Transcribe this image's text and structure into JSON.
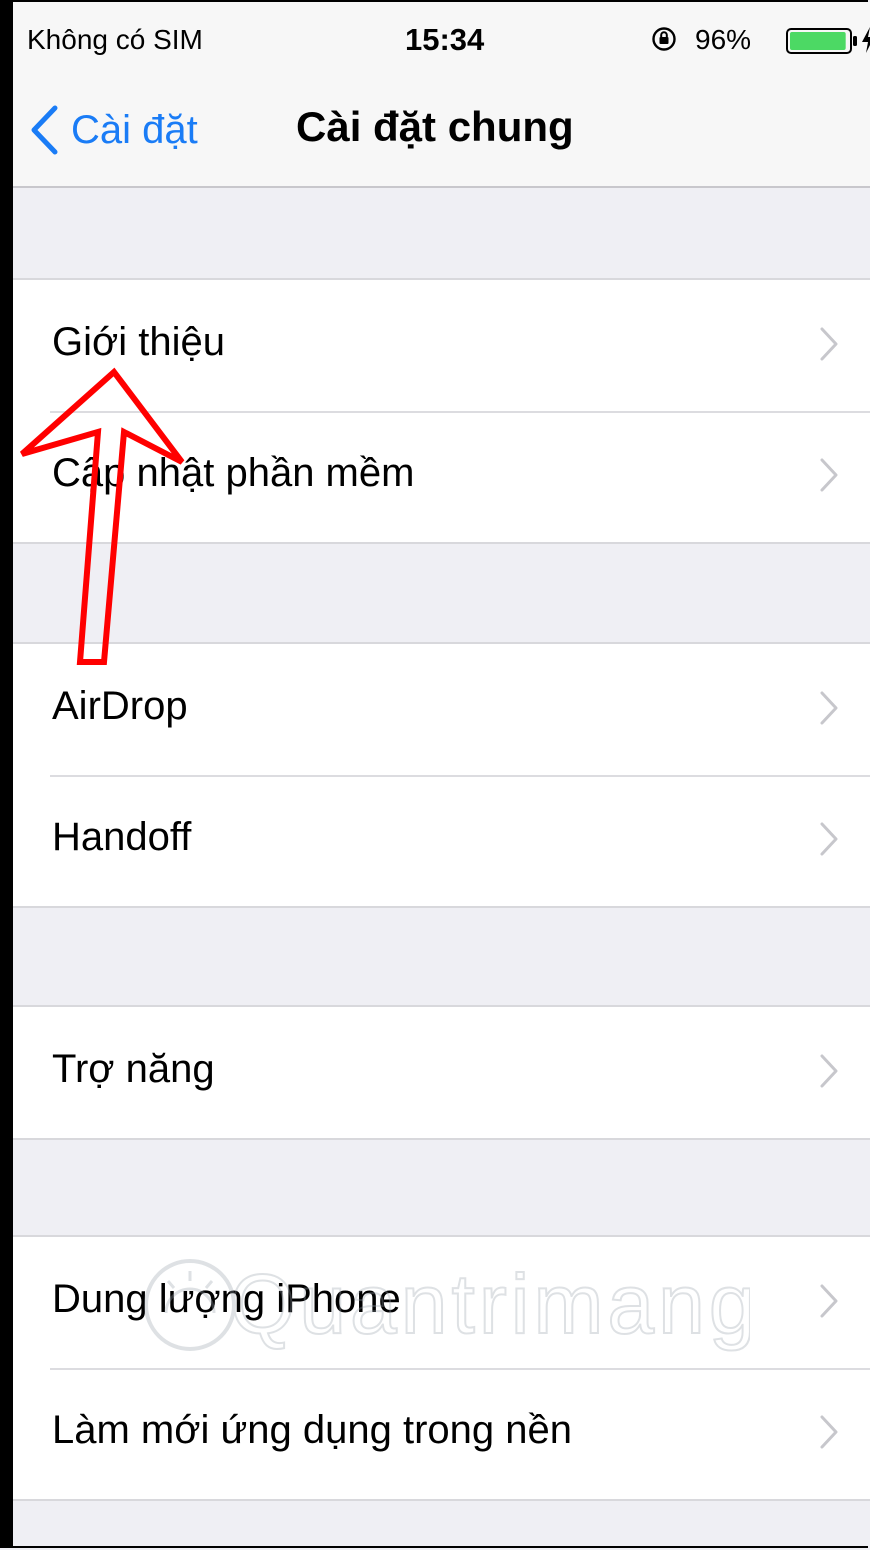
{
  "status_bar": {
    "carrier": "Không có SIM",
    "time": "15:34",
    "battery_percent": "96%",
    "battery_level": 0.96,
    "icons": [
      "orientation-lock-icon",
      "battery-icon",
      "charging-bolt-icon"
    ]
  },
  "nav": {
    "back_label": "Cài đặt",
    "title": "Cài đặt chung"
  },
  "groups": [
    [
      "Giới thiệu",
      "Cập nhật phần mềm"
    ],
    [
      "AirDrop",
      "Handoff"
    ],
    [
      "Trợ năng"
    ],
    [
      "Dung lượng iPhone",
      "Làm mới ứng dụng trong nền"
    ]
  ],
  "watermark": "Quantrimang",
  "colors": {
    "accent": "#1a7cf6",
    "background": "#efeff4",
    "annotation_arrow": "#ff0000",
    "battery": "#4cd964"
  }
}
